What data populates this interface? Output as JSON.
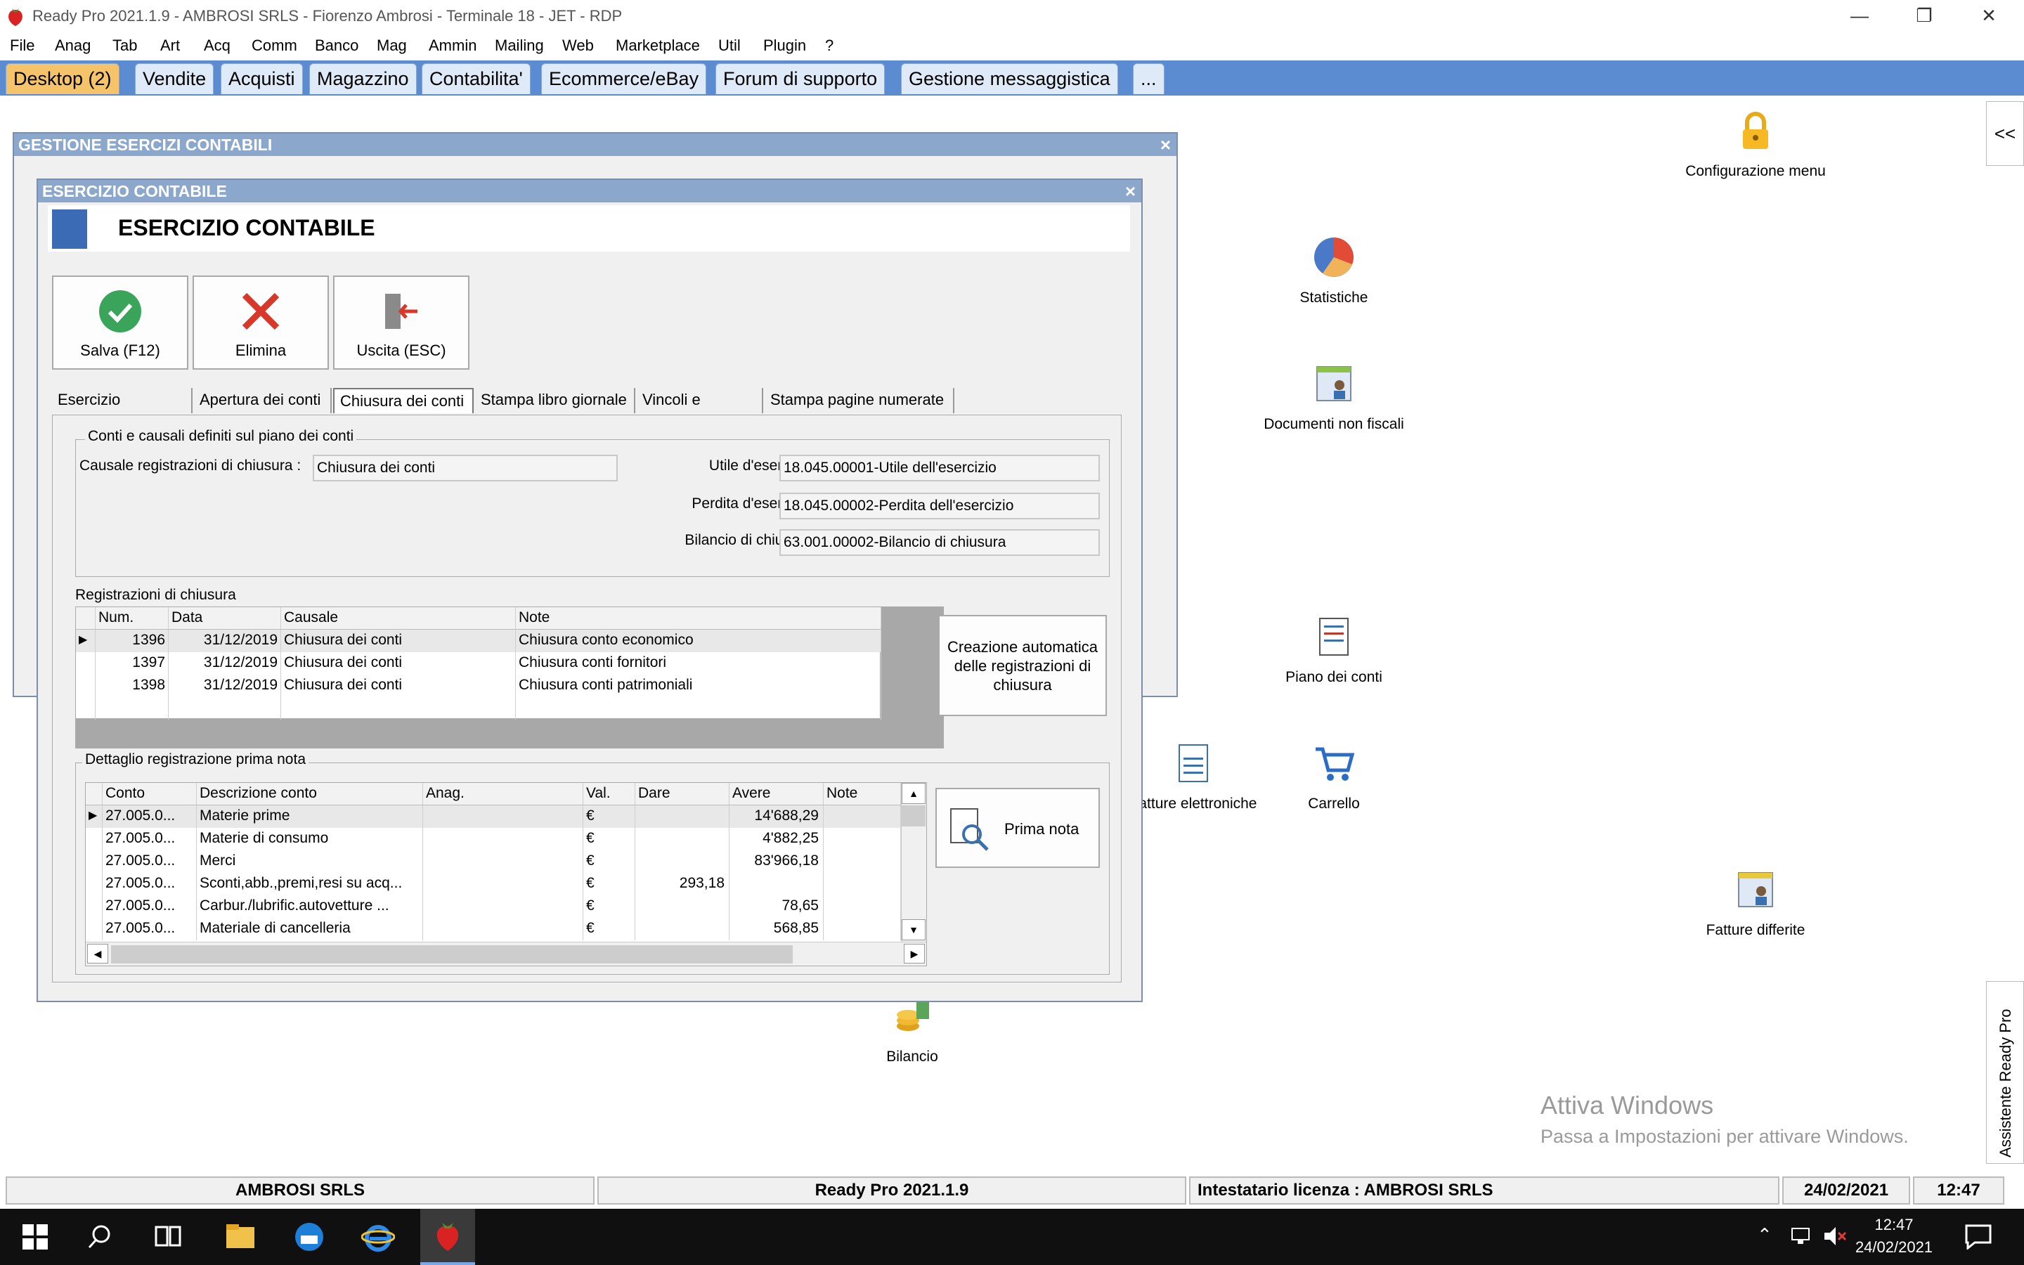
{
  "app": {
    "title": "Ready Pro 2021.1.9 - AMBROSI SRLS - Fiorenzo Ambrosi - Terminale 18 - JET - RDP"
  },
  "menu": [
    "File",
    "Anag",
    "Tab",
    "Art",
    "Acq",
    "Comm",
    "Banco",
    "Mag",
    "Ammin",
    "Mailing",
    "Web",
    "Marketplace",
    "Util",
    "Plugin",
    "?"
  ],
  "tabs": [
    "Desktop (2)",
    "Vendite",
    "Acquisti",
    "Magazzino",
    "Contabilita'",
    "Ecommerce/eBay",
    "Forum di supporto",
    "Gestione messaggistica",
    "..."
  ],
  "desktop": {
    "config": "Configurazione menu",
    "stat": "Statistiche",
    "docs": "Documenti non fiscali",
    "piano": "Piano dei conti",
    "fatture_el": "Fatture elettroniche",
    "carrello": "Carrello",
    "fatture_diff": "Fatture differite",
    "bilancio": "Bilancio",
    "side_collapse": "<<",
    "assistente": "Assistente Ready Pro",
    "activate_title": "Attiva Windows",
    "activate_sub": "Passa a Impostazioni per attivare Windows."
  },
  "back_window": {
    "title": "GESTIONE ESERCIZI CONTABILI",
    "close": "×"
  },
  "dialog": {
    "title": "ESERCIZIO CONTABILE",
    "heading": "ESERCIZIO CONTABILE",
    "close": "×",
    "save": "Salva (F12)",
    "delete": "Elimina",
    "exit": "Uscita (ESC)",
    "tabs": [
      "Esercizio contabile",
      "Apertura dei conti",
      "Chiusura dei conti",
      "Stampa libro giornale",
      "Vincoli e controlli",
      "Stampa pagine numerate"
    ],
    "group1": "Conti e causali definiti sul piano dei conti",
    "causale_label": "Causale registrazioni di chiusura :",
    "causale_value": "Chiusura dei conti",
    "utile_label": "Utile d'esercizio :",
    "utile_value": "18.045.00001-Utile dell'esercizio",
    "perdita_label": "Perdita d'esercizio :",
    "perdita_value": "18.045.00002-Perdita dell'esercizio",
    "bilancio_label": "Bilancio di chiusura :",
    "bilancio_value": "63.001.00002-Bilancio di chiusura",
    "reg_title": "Registrazioni di chiusura",
    "reg_headers": [
      "Num.",
      "Data",
      "Causale",
      "Note"
    ],
    "reg_rows": [
      [
        "1396",
        "31/12/2019",
        "Chiusura dei conti",
        "Chiusura conto economico"
      ],
      [
        "1397",
        "31/12/2019",
        "Chiusura dei conti",
        "Chiusura conti fornitori"
      ],
      [
        "1398",
        "31/12/2019",
        "Chiusura dei conti",
        "Chiusura conti patrimoniali"
      ]
    ],
    "auto_btn": "Creazione automatica delle registrazioni di chiusura",
    "det_title": "Dettaglio registrazione prima nota",
    "det_headers": [
      "Conto",
      "Descrizione conto",
      "Anag.",
      "Val.",
      "Dare",
      "Avere",
      "Note"
    ],
    "det_rows": [
      [
        "27.005.0...",
        "Materie prime",
        "",
        "€",
        "",
        "14'688,29",
        ""
      ],
      [
        "27.005.0...",
        "Materie di consumo",
        "",
        "€",
        "",
        "4'882,25",
        ""
      ],
      [
        "27.005.0...",
        "Merci",
        "",
        "€",
        "",
        "83'966,18",
        ""
      ],
      [
        "27.005.0...",
        "Sconti,abb.,premi,resi su acq...",
        "",
        "€",
        "293,18",
        "",
        ""
      ],
      [
        "27.005.0...",
        "Carbur./lubrific.autovetture ...",
        "",
        "€",
        "",
        "78,65",
        ""
      ],
      [
        "27.005.0...",
        "Materiale di cancelleria",
        "",
        "€",
        "",
        "568,85",
        ""
      ]
    ],
    "prima_nota": "Prima nota"
  },
  "statusbar": {
    "company": "AMBROSI SRLS",
    "version": "Ready Pro 2021.1.9",
    "license": "Intestatario licenza : AMBROSI SRLS",
    "date": "24/02/2021",
    "time": "12:47"
  },
  "taskbar": {
    "time": "12:47",
    "date": "24/02/2021"
  },
  "colors": {
    "tabbar": "#5b8bd0",
    "active_tab": "#f5c46a",
    "caption": "#8ba7cc"
  }
}
